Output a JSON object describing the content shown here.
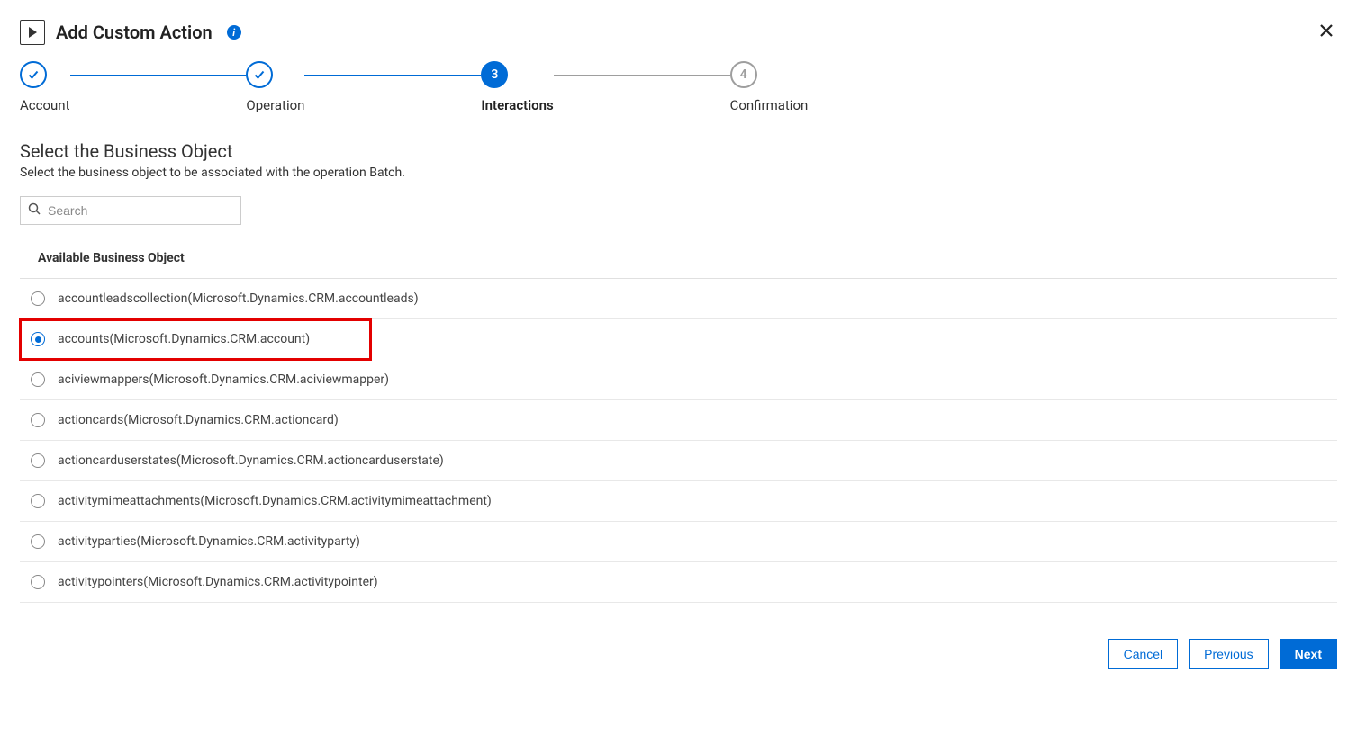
{
  "header": {
    "title": "Add Custom Action"
  },
  "stepper": {
    "steps": [
      {
        "label": "Account",
        "state": "done",
        "mark": "check"
      },
      {
        "label": "Operation",
        "state": "done",
        "mark": "check"
      },
      {
        "label": "Interactions",
        "state": "current",
        "mark": "3"
      },
      {
        "label": "Confirmation",
        "state": "pending",
        "mark": "4"
      }
    ]
  },
  "section": {
    "title": "Select the Business Object",
    "subtitle": "Select the business object to be associated with the operation Batch."
  },
  "search": {
    "placeholder": "Search",
    "value": ""
  },
  "table": {
    "header": "Available Business Object",
    "rows": [
      {
        "label": "accountleadscollection(Microsoft.Dynamics.CRM.accountleads)",
        "selected": false,
        "highlighted": false
      },
      {
        "label": "accounts(Microsoft.Dynamics.CRM.account)",
        "selected": true,
        "highlighted": true
      },
      {
        "label": "aciviewmappers(Microsoft.Dynamics.CRM.aciviewmapper)",
        "selected": false,
        "highlighted": false
      },
      {
        "label": "actioncards(Microsoft.Dynamics.CRM.actioncard)",
        "selected": false,
        "highlighted": false
      },
      {
        "label": "actioncarduserstates(Microsoft.Dynamics.CRM.actioncarduserstate)",
        "selected": false,
        "highlighted": false
      },
      {
        "label": "activitymimeattachments(Microsoft.Dynamics.CRM.activitymimeattachment)",
        "selected": false,
        "highlighted": false
      },
      {
        "label": "activityparties(Microsoft.Dynamics.CRM.activityparty)",
        "selected": false,
        "highlighted": false
      },
      {
        "label": "activitypointers(Microsoft.Dynamics.CRM.activitypointer)",
        "selected": false,
        "highlighted": false
      }
    ]
  },
  "footer": {
    "cancel": "Cancel",
    "previous": "Previous",
    "next": "Next"
  }
}
